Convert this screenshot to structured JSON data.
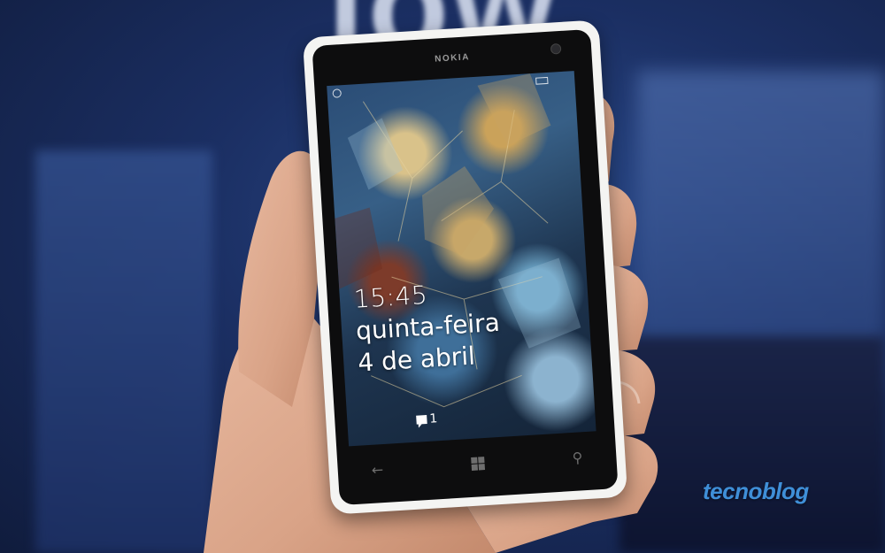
{
  "phone": {
    "brand": "NOKIA",
    "lockscreen": {
      "time": "15:45",
      "day": "quinta-feira",
      "date": "4 de abril",
      "notification_count": "1"
    },
    "nav": {
      "back_icon": "back-arrow-icon",
      "start_icon": "windows-logo-icon",
      "search_icon": "search-icon"
    }
  },
  "watermark": "tecnoblog",
  "colors": {
    "background": "#1b2f63",
    "phone_body": "#f4f4f2",
    "watermark": "#3f8fd8"
  }
}
